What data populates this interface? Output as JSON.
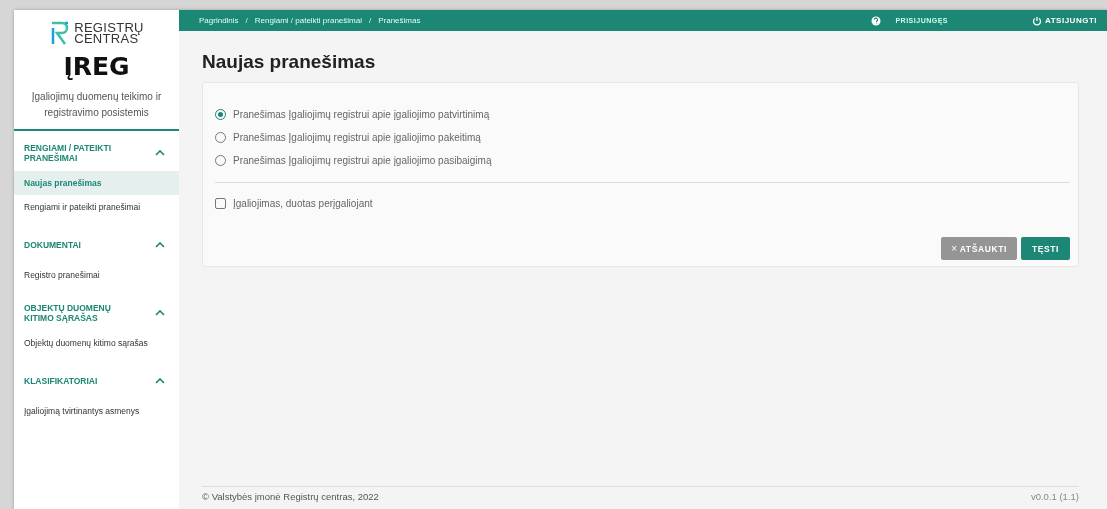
{
  "logo": {
    "line_1": "REGISTRŲ",
    "line_2": "CENTRAS"
  },
  "app": {
    "title": "ĮREG",
    "subtitle": "Įgaliojimų duomenų teikimo ir registravimo posistemis"
  },
  "sidebar": {
    "sections": [
      {
        "title": "RENGIAMI / PATEIKTI PRANEŠIMAI",
        "expanded": true,
        "items": [
          {
            "label": "Naujas pranešimas",
            "selected": true
          },
          {
            "label": "Rengiami ir pateikti pranešimai",
            "selected": false
          }
        ]
      },
      {
        "title": "DOKUMENTAI",
        "expanded": true,
        "items": [
          {
            "label": "Registro pranešimai",
            "selected": false
          }
        ]
      },
      {
        "title": "OBJEKTŲ DUOMENŲ KITIMO SĄRAŠAS",
        "expanded": true,
        "items": [
          {
            "label": "Objektų duomenų kitimo sąrašas",
            "selected": false
          }
        ]
      },
      {
        "title": "KLASIFIKATORIAI",
        "expanded": true,
        "items": [
          {
            "label": "Įgaliojimą tvirtinantys asmenys",
            "selected": false
          }
        ]
      }
    ]
  },
  "breadcrumbs": [
    "Pagrindinis",
    "Rengiami / pateikti pranešimai",
    "Pranešimas"
  ],
  "breadcrumb_separator": "/",
  "topbar": {
    "user": "PRISIJUNGĘS",
    "logout": "ATSIJUNGTI"
  },
  "page_title": "Naujas pranešimas",
  "options": [
    {
      "label": "Pranešimas Įgaliojimų registrui apie įgaliojimo patvirtinimą",
      "selected": true
    },
    {
      "label": "Pranešimas Įgaliojimų registrui apie įgaliojimo pakeitimą",
      "selected": false
    },
    {
      "label": "Pranešimas Įgaliojimų registrui apie įgaliojimo pasibaigimą",
      "selected": false
    }
  ],
  "checkbox": {
    "label": "Įgaliojimas, duotas perįgaliojant",
    "checked": false
  },
  "buttons": {
    "cancel_icon": "×",
    "cancel": "ATŠAUKTI",
    "continue": "TĘSTI"
  },
  "footer": {
    "copyright": "© Valstybės įmonė Registrų centras, 2022",
    "version": "v0.0.1 (1.1)"
  }
}
